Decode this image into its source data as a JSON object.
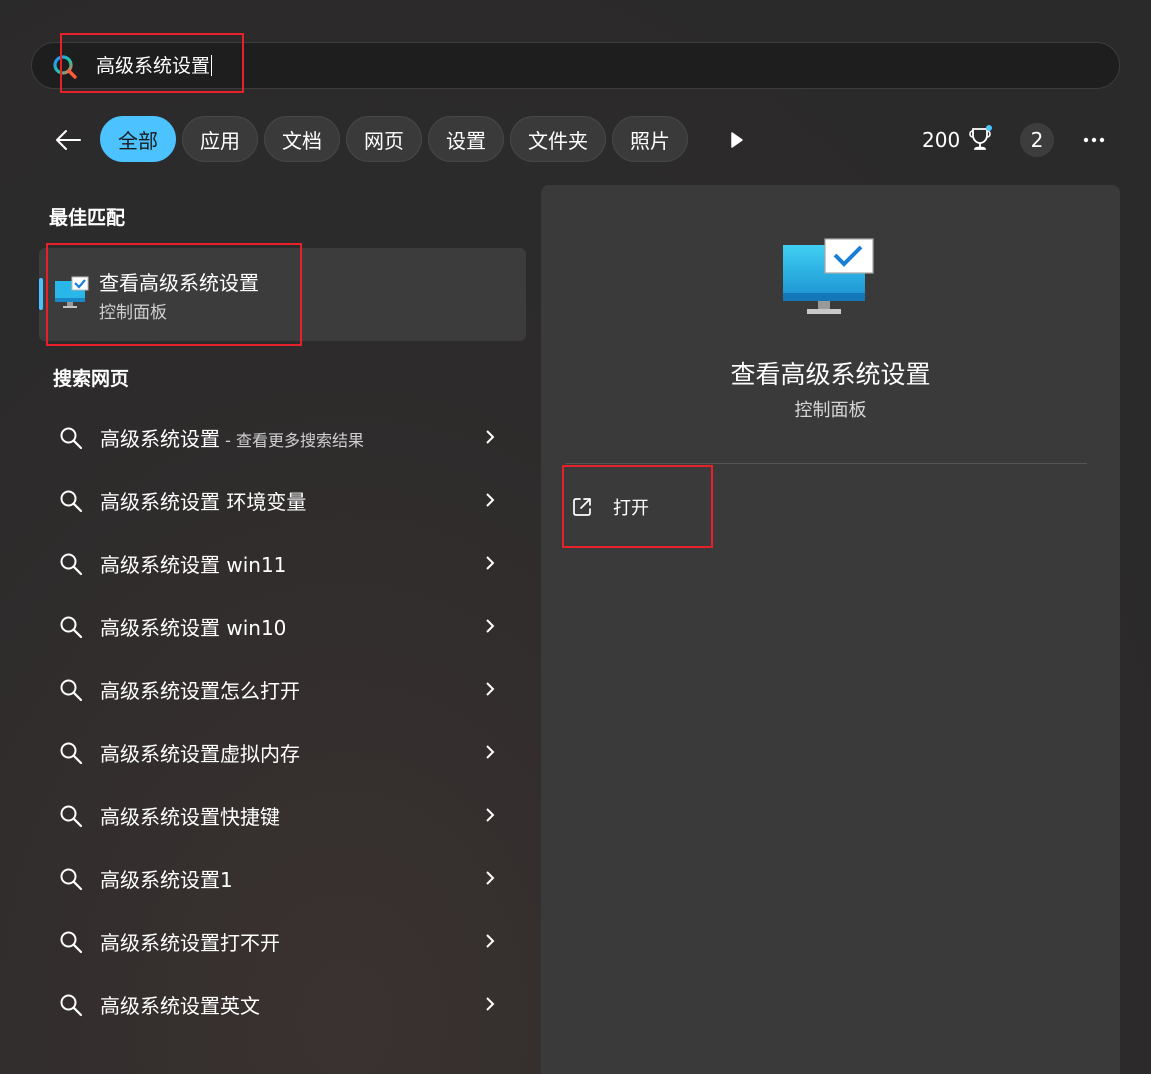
{
  "search": {
    "query": "高级系统设置"
  },
  "filters": {
    "chips": [
      "全部",
      "应用",
      "文档",
      "网页",
      "设置",
      "文件夹",
      "照片"
    ],
    "active": "全部"
  },
  "rewards": {
    "points": "200",
    "count": "2"
  },
  "best_match": {
    "section_title": "最佳匹配",
    "title": "查看高级系统设置",
    "subtitle": "控制面板"
  },
  "web_search": {
    "section_title": "搜索网页",
    "results": [
      {
        "main": "高级系统设置",
        "suffix": " - 查看更多搜索结果"
      },
      {
        "main": "高级系统设置 环境变量",
        "suffix": ""
      },
      {
        "main": "高级系统设置 win11",
        "suffix": ""
      },
      {
        "main": "高级系统设置 win10",
        "suffix": ""
      },
      {
        "main": "高级系统设置怎么打开",
        "suffix": ""
      },
      {
        "main": "高级系统设置虚拟内存",
        "suffix": ""
      },
      {
        "main": "高级系统设置快捷键",
        "suffix": ""
      },
      {
        "main": "高级系统设置1",
        "suffix": ""
      },
      {
        "main": "高级系统设置打不开",
        "suffix": ""
      },
      {
        "main": "高级系统设置英文",
        "suffix": ""
      }
    ]
  },
  "detail": {
    "title": "查看高级系统设置",
    "subtitle": "控制面板",
    "action_open": "打开"
  },
  "colors": {
    "accent": "#4cc2ff",
    "highlight_box": "#e8202a"
  },
  "icons": {
    "search": "search-icon",
    "back": "arrow-left-icon",
    "play": "play-icon",
    "trophy": "trophy-icon",
    "more": "more-horizontal-icon",
    "control_panel": "monitor-checkmark-icon",
    "chevron": "chevron-right-icon",
    "open": "open-external-icon"
  }
}
